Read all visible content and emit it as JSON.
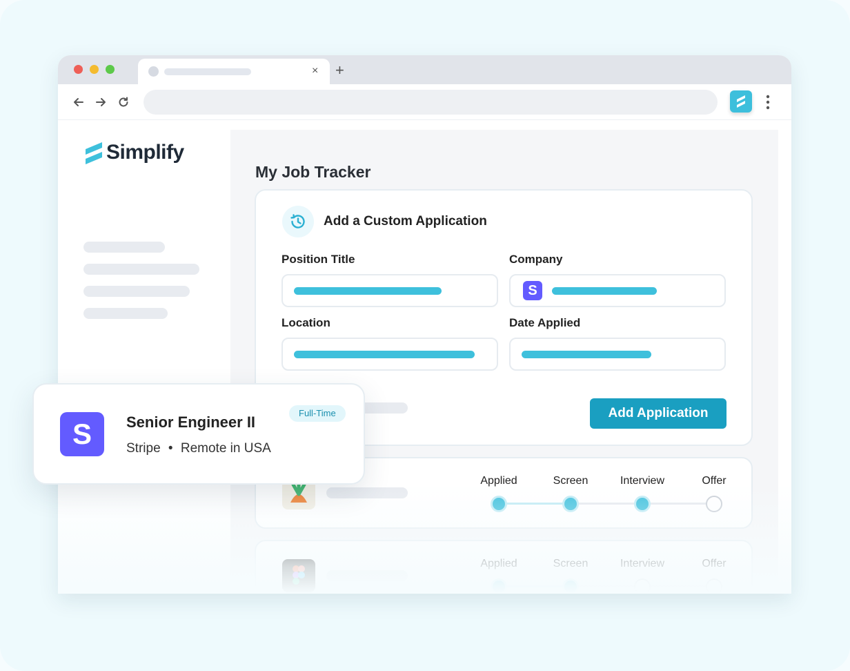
{
  "browser": {
    "window_controls": [
      "close",
      "minimize",
      "maximize"
    ],
    "tab": {
      "close_label": "×"
    },
    "new_tab_label": "+"
  },
  "app": {
    "name": "Simplify"
  },
  "tracker": {
    "title": "My Job Tracker",
    "form": {
      "title": "Add a Custom Application",
      "fields": {
        "position_title": "Position Title",
        "company": "Company",
        "location": "Location",
        "date_applied": "Date Applied"
      },
      "company_logo_letter": "S",
      "submit_label": "Add Application"
    },
    "stages": [
      "Applied",
      "Screen",
      "Interview",
      "Offer"
    ],
    "applications": [
      {
        "logo": "carrot-logo-icon",
        "stages_completed": 3
      },
      {
        "logo": "figma-logo-icon",
        "stages_completed": 2
      }
    ]
  },
  "job_card": {
    "logo_letter": "S",
    "title": "Senior Engineer II",
    "company": "Stripe",
    "separator": "•",
    "location": "Remote in USA",
    "badge": "Full-Time"
  },
  "colors": {
    "accent": "#3ec0dc",
    "button": "#1a9fc1",
    "stripe": "#635bff"
  }
}
